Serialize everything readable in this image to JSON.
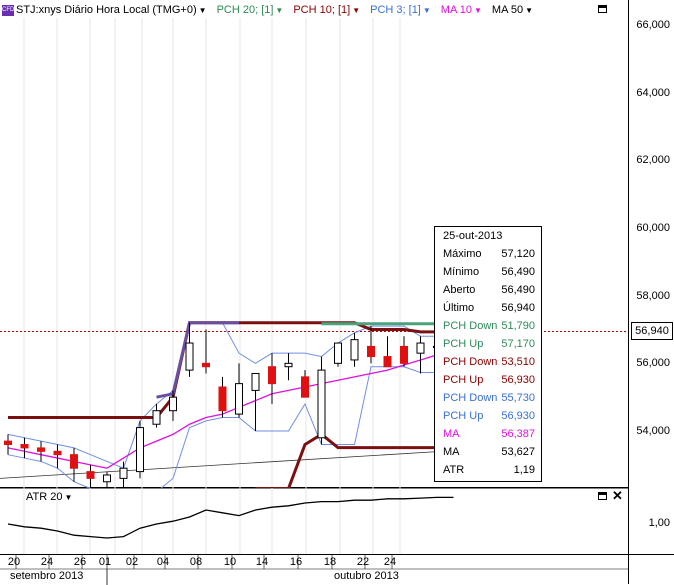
{
  "legend": {
    "symbol_badge": "CFD",
    "symbol": "STJ:xnys Diário Hora Local (TMG+0)",
    "items": [
      {
        "label": "PCH 20; [1]",
        "color": "#2e8b57"
      },
      {
        "label": "PCH 10; [1]",
        "color": "#8b0000"
      },
      {
        "label": "PCH 3; [1]",
        "color": "#3a6fd8"
      },
      {
        "label": "MA 10",
        "color": "#e010e0"
      },
      {
        "label": "MA 50",
        "color": "#000000"
      }
    ]
  },
  "price_axis": {
    "labels": [
      "66,000",
      "64,000",
      "62,000",
      "60,000",
      "58,000",
      "56,000",
      "54,000"
    ],
    "current_price": "56,940"
  },
  "data_window": {
    "date": "25-out-2013",
    "rows": [
      {
        "label": "Máximo",
        "value": "57,120",
        "color": "#000000"
      },
      {
        "label": "Mínimo",
        "value": "56,490",
        "color": "#000000"
      },
      {
        "label": "Aberto",
        "value": "56,490",
        "color": "#000000"
      },
      {
        "label": "Último",
        "value": "56,940",
        "color": "#000000"
      },
      {
        "label": "PCH Down",
        "value": "51,790",
        "color": "#2e8b57"
      },
      {
        "label": "PCH Up",
        "value": "57,170",
        "color": "#2e8b57"
      },
      {
        "label": "PCH Down",
        "value": "53,510",
        "color": "#8b0000"
      },
      {
        "label": "PCH Up",
        "value": "56,930",
        "color": "#8b0000"
      },
      {
        "label": "PCH Down",
        "value": "55,730",
        "color": "#3a6fd8"
      },
      {
        "label": "PCH Up",
        "value": "56,930",
        "color": "#3a6fd8"
      },
      {
        "label": "MA",
        "value": "56,387",
        "color": "#e010e0"
      },
      {
        "label": "MA",
        "value": "53,627",
        "color": "#000000"
      },
      {
        "label": "ATR",
        "value": "1,19",
        "color": "#000000"
      }
    ]
  },
  "atr_pane": {
    "label": "ATR 20",
    "axis_label": "1,00"
  },
  "time_axis": {
    "days": [
      "20",
      "24",
      "26",
      "01",
      "02",
      "04",
      "08",
      "10",
      "14",
      "16",
      "18",
      "22",
      "24"
    ],
    "months": [
      "setembro 2013",
      "outubro 2013"
    ]
  },
  "chart_data": {
    "type": "candlestick",
    "dates": [
      "2013-09-18",
      "2013-09-19",
      "2013-09-20",
      "2013-09-23",
      "2013-09-24",
      "2013-09-25",
      "2013-09-26",
      "2013-09-27",
      "2013-09-30",
      "2013-10-01",
      "2013-10-02",
      "2013-10-03",
      "2013-10-04",
      "2013-10-07",
      "2013-10-08",
      "2013-10-09",
      "2013-10-10",
      "2013-10-11",
      "2013-10-14",
      "2013-10-15",
      "2013-10-16",
      "2013-10-17",
      "2013-10-18",
      "2013-10-21",
      "2013-10-22",
      "2013-10-23",
      "2013-10-24",
      "2013-10-25"
    ],
    "open": [
      53.7,
      53.6,
      53.5,
      53.4,
      53.3,
      52.8,
      52.5,
      52.6,
      52.8,
      54.2,
      54.6,
      55.8,
      56.0,
      55.3,
      54.5,
      55.2,
      55.9,
      55.9,
      55.6,
      53.8,
      56.0,
      56.1,
      56.5,
      56.2,
      56.5,
      56.3,
      56.5,
      56.49
    ],
    "high": [
      53.9,
      53.8,
      53.7,
      53.6,
      53.5,
      53.0,
      52.8,
      53.1,
      54.3,
      54.8,
      55.2,
      57.2,
      57.0,
      55.6,
      56.0,
      55.6,
      56.3,
      56.3,
      55.8,
      56.2,
      56.6,
      56.9,
      57.1,
      56.8,
      56.8,
      56.8,
      56.7,
      57.12
    ],
    "low": [
      53.3,
      53.2,
      53.1,
      52.9,
      52.5,
      52.3,
      52.2,
      52.2,
      52.6,
      54.1,
      54.3,
      55.6,
      55.7,
      54.4,
      54.4,
      54.0,
      54.8,
      55.5,
      55.0,
      53.6,
      55.9,
      55.9,
      56.0,
      56.0,
      55.9,
      55.7,
      56.4,
      56.49
    ],
    "close": [
      53.6,
      53.5,
      53.4,
      53.3,
      52.9,
      52.6,
      52.7,
      52.9,
      54.1,
      54.6,
      55.0,
      56.6,
      55.9,
      54.6,
      55.4,
      55.7,
      55.4,
      56.0,
      55.0,
      55.8,
      56.6,
      56.7,
      56.2,
      55.9,
      56.0,
      56.6,
      56.5,
      56.94
    ],
    "pch20_up": 57.17,
    "pch20_down": 51.79,
    "pch10_up": 56.93,
    "pch10_down": 53.51,
    "pch3_up": 56.93,
    "pch3_down": 55.73,
    "ma10_last": 56.387,
    "ma50_last": 53.627,
    "atr20_last": 1.19,
    "ylim": [
      52.3,
      66.7
    ]
  }
}
